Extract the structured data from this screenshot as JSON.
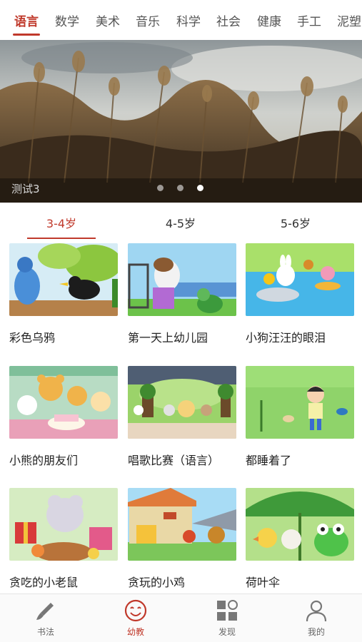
{
  "categories": [
    "语言",
    "数学",
    "美术",
    "音乐",
    "科学",
    "社会",
    "健康",
    "手工",
    "泥塑"
  ],
  "active_category": "语言",
  "banner": {
    "caption": "测试3",
    "dots": 3,
    "active_dot": 3
  },
  "age_tabs": [
    "3-4岁",
    "4-5岁",
    "5-6岁"
  ],
  "active_age_tab": "3-4岁",
  "videos": [
    {
      "title": "彩色乌鸦"
    },
    {
      "title": "第一天上幼儿园"
    },
    {
      "title": "小狗汪汪的眼泪"
    },
    {
      "title": "小熊的朋友们"
    },
    {
      "title": "唱歌比赛（语言）"
    },
    {
      "title": "都睡着了"
    },
    {
      "title": "贪吃的小老鼠"
    },
    {
      "title": "贪玩的小鸡"
    },
    {
      "title": "荷叶伞"
    }
  ],
  "bottom_nav": [
    {
      "label": "书法",
      "icon": "brush-icon"
    },
    {
      "label": "幼教",
      "icon": "smiley-icon"
    },
    {
      "label": "发现",
      "icon": "grid-icon"
    },
    {
      "label": "我的",
      "icon": "person-icon"
    }
  ],
  "active_nav": "幼教",
  "colors": {
    "accent": "#c0392b",
    "text": "#222222",
    "muted": "#666666"
  }
}
